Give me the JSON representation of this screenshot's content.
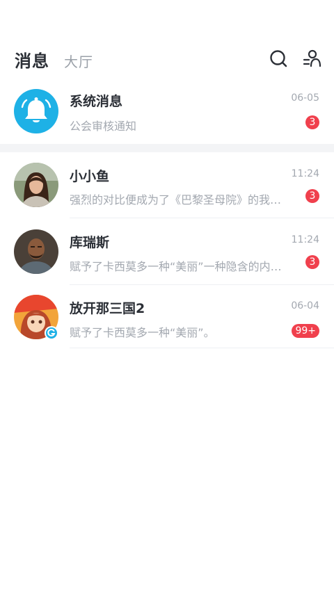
{
  "header": {
    "active_tab": "消息",
    "inactive_tab": "大厅",
    "icons": [
      "search-icon",
      "user-list-icon"
    ]
  },
  "conversations": [
    {
      "name": "系统消息",
      "time": "06-05",
      "preview": "公会审核通知",
      "badge": "3",
      "avatar": "bell-icon"
    },
    {
      "name": "小小鱼",
      "time": "11:24",
      "preview": "强烈的对比便成为了《巴黎圣母院》的我…",
      "badge": "3",
      "avatar": "user-photo"
    },
    {
      "name": "库瑞斯",
      "time": "11:24",
      "preview": "赋予了卡西莫多一种“美丽”一种隐含的内…",
      "badge": "3",
      "avatar": "user-photo"
    },
    {
      "name": "放开那三国2",
      "time": "06-04",
      "preview": "赋予了卡西莫多一种“美丽”。",
      "badge": "99+",
      "avatar": "game-logo"
    }
  ],
  "colors": {
    "accent": "#1eb1e6",
    "badge": "#f0404d",
    "text_primary": "#2b2f36",
    "text_secondary": "#a3a8b0"
  }
}
